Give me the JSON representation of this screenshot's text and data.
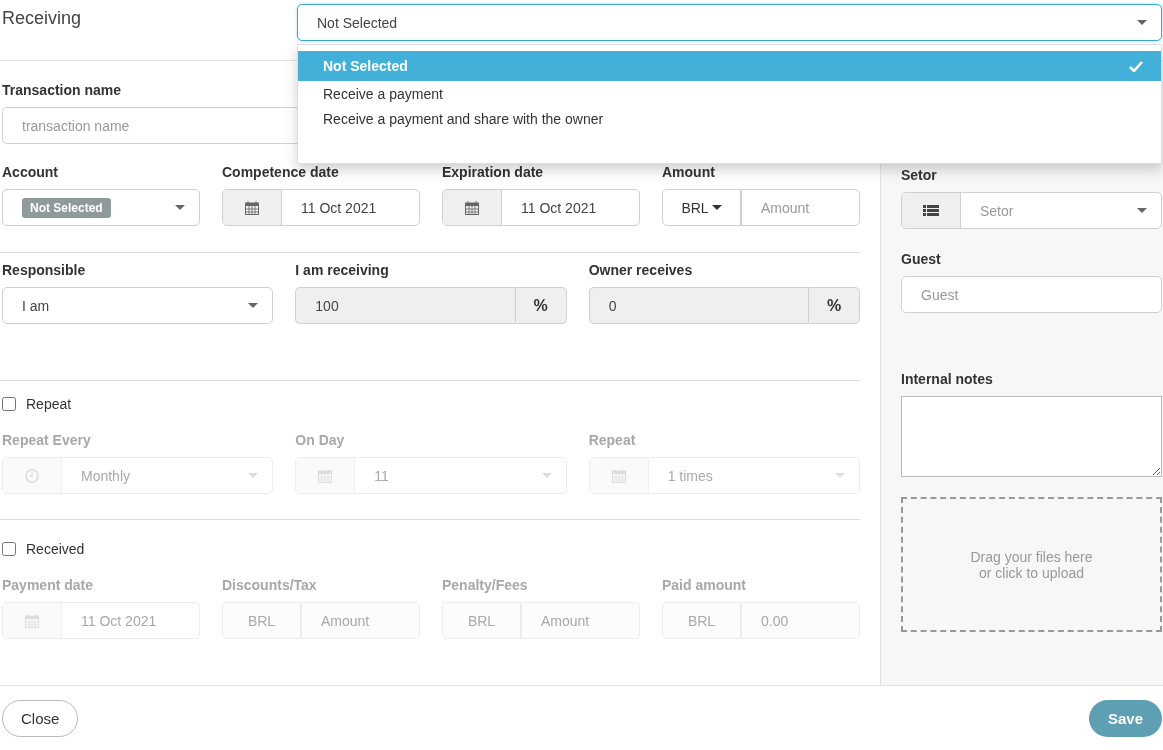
{
  "header": {
    "title": "Receiving",
    "type_select": {
      "value": "Not Selected",
      "open": true,
      "options": [
        {
          "label": "Not Selected",
          "selected": true
        },
        {
          "label": "Receive a payment",
          "selected": false
        },
        {
          "label": "Receive a payment and share with the owner",
          "selected": false
        }
      ]
    }
  },
  "sections": [
    {
      "rows": [
        [
          {
            "kind": "text",
            "label": "Transaction name",
            "placeholder": "transaction name",
            "disabled": false
          }
        ],
        [
          {
            "kind": "badge-select",
            "label": "Account",
            "badge": "Not Selected",
            "disabled": false
          },
          {
            "kind": "date",
            "label": "Competence date",
            "value": "11 Oct 2021",
            "disabled": false
          },
          {
            "kind": "date",
            "label": "Expiration date",
            "value": "11 Oct 2021",
            "disabled": false
          },
          {
            "kind": "currency",
            "label": "Amount",
            "currency": "BRL",
            "currency_menu": true,
            "placeholder": "Amount",
            "disabled": false
          }
        ]
      ]
    },
    {
      "rows": [
        [
          {
            "kind": "select",
            "label": "Responsible",
            "value": "I am",
            "disabled": false
          },
          {
            "kind": "percent",
            "label": "I am receiving",
            "value": "100",
            "unit": "%",
            "disabled": false
          },
          {
            "kind": "percent",
            "label": "Owner receives",
            "value": "0",
            "unit": "%",
            "disabled": false
          }
        ]
      ]
    },
    {
      "checkbox": {
        "label": "Repeat",
        "checked": false
      },
      "rows": [
        [
          {
            "kind": "period-select",
            "label": "Repeat Every",
            "value": "Monthly",
            "disabled": true
          },
          {
            "kind": "day-select",
            "label": "On Day",
            "value": "11",
            "disabled": true
          },
          {
            "kind": "count-select",
            "label": "Repeat",
            "value": "1 times",
            "disabled": true
          }
        ]
      ]
    },
    {
      "checkbox": {
        "label": "Received",
        "checked": false
      },
      "rows": [
        [
          {
            "kind": "date",
            "label": "Payment date",
            "value": "11 Oct 2021",
            "disabled": true
          },
          {
            "kind": "currency",
            "label": "Discounts/Tax",
            "currency": "BRL",
            "currency_menu": false,
            "placeholder": "Amount",
            "disabled": true
          },
          {
            "kind": "currency",
            "label": "Penalty/Fees",
            "currency": "BRL",
            "currency_menu": false,
            "placeholder": "Amount",
            "disabled": true
          },
          {
            "kind": "currency",
            "label": "Paid amount",
            "currency": "BRL",
            "currency_menu": false,
            "placeholder": "0.00",
            "disabled": true
          }
        ]
      ]
    }
  ],
  "sidebar": {
    "fields": [
      {
        "kind": "category-select",
        "label": "Setor",
        "placeholder": "Setor",
        "disabled": false
      },
      {
        "kind": "text",
        "label": "Guest",
        "placeholder": "Guest",
        "disabled": false
      }
    ],
    "notes": {
      "label": "Internal notes"
    },
    "upload": {
      "text": "Drag your files here or click to upload"
    }
  },
  "footer": {
    "buttons": [
      {
        "label": "Close",
        "kind": "secondary"
      },
      {
        "label": "Save",
        "kind": "primary"
      }
    ]
  }
}
